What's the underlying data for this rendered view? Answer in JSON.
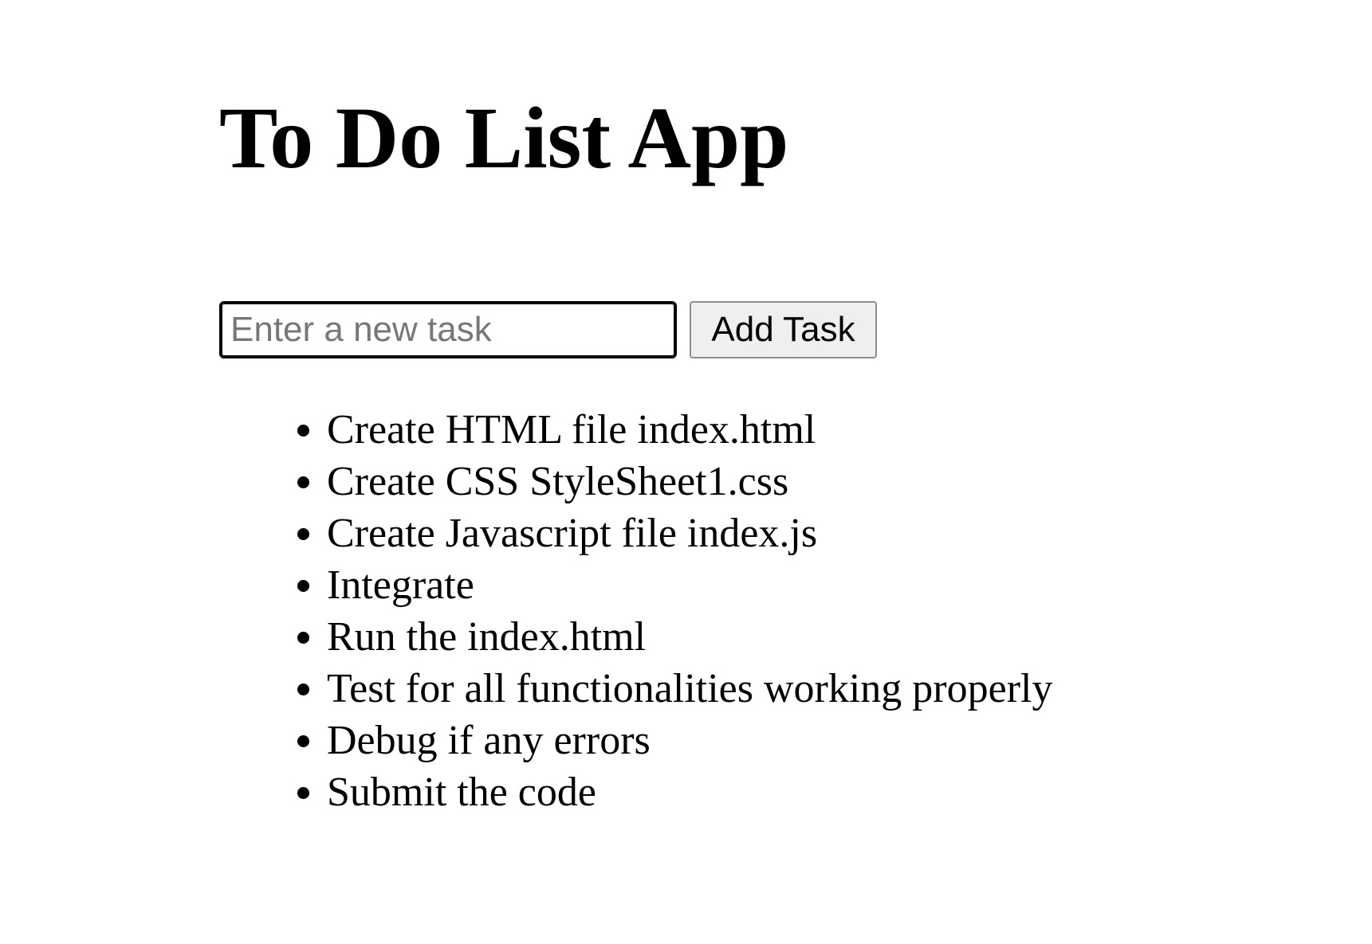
{
  "page": {
    "title": "To Do List App"
  },
  "task_form": {
    "input_value": "",
    "input_placeholder": "Enter a new task",
    "add_button_label": "Add Task"
  },
  "tasks": [
    "Create HTML file index.html",
    "Create CSS StyleSheet1.css",
    "Create Javascript file index.js",
    "Integrate",
    "Run the index.html",
    "Test for all functionalities working properly",
    "Debug if any errors",
    "Submit the code"
  ]
}
